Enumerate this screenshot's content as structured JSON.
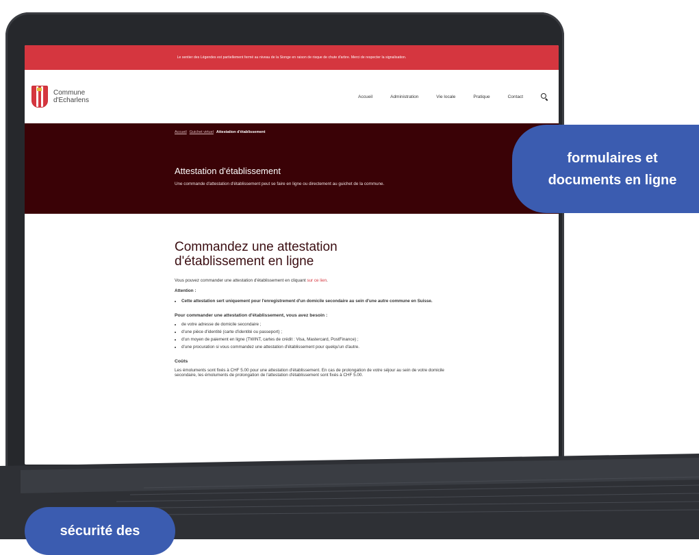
{
  "alert": "Le sentier des Légendes est partiellement fermé au niveau de la Sionge en raison de risque de chute d'arbre. Merci de respecter la signalisation.",
  "site": {
    "logo_line1": "Commune",
    "logo_line2": "d'Echarlens"
  },
  "nav": [
    "Accueil",
    "Administration",
    "Vie locale",
    "Pratique",
    "Contact"
  ],
  "breadcrumb": {
    "home": "Accueil",
    "parent": "Guichet virtuel",
    "current": "Attestation d'établissement"
  },
  "hero": {
    "title": "Attestation d'établissement",
    "subtitle": "Une commande d'attestation d'établissement peut se faire en ligne ou directement au guichet de la commune."
  },
  "content": {
    "heading": "Commandez une attestation d'établissement en ligne",
    "intro_prefix": "Vous pouvez commander une attestation d'établissement en cliquant ",
    "intro_link": "sur ce lien",
    "intro_suffix": ".",
    "attention_label": "Attention :",
    "attention_item": "Cette attestation sert uniquement pour l'enregistrement d'un domicile secondaire au sein d'une autre commune en Suisse.",
    "need_title": "Pour commander une attestation d'établissement, vous avez besoin :",
    "need_items": [
      "de votre adresse de domicile secondaire ;",
      "d'une pièce d'identité (carte d'identité ou passeport) ;",
      "d'un moyen de paiement en ligne (TWINT, cartes de crédit : Visa, Mastercard, PostFinance) ;",
      "d'une procuration si vous commandez une attestation d'établissement pour quelqu'un d'autre."
    ],
    "costs_title": "Coûts",
    "costs_text": "Les émoluments sont fixés à CHF 5.00 pour une attestation d'établissement. En cas de prolongation de votre séjour au sein de votre domicile secondaire, les émoluments de prolongation de l'attestation d'établissement sont fixés à CHF 5.00."
  },
  "badges": {
    "top_line1": "formulaires et",
    "top_line2": "documents en ligne",
    "bottom": "sécurité des"
  },
  "colors": {
    "accent_red": "#d5363f",
    "hero_bg": "#3a0206",
    "badge_blue": "#3b5cb0",
    "bezel": "#26282c"
  }
}
